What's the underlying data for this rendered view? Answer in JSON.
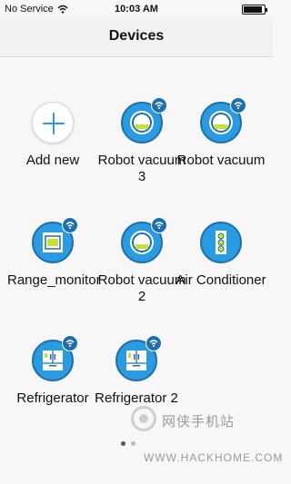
{
  "status_bar": {
    "carrier": "No Service",
    "time": "10:03 AM",
    "battery_level": 0.9
  },
  "header": {
    "title": "Devices"
  },
  "devices": [
    {
      "label": "Add new",
      "icon": "plus-icon"
    },
    {
      "label": "Robot vacuum 3",
      "icon": "robot-vacuum-icon",
      "wifi": true
    },
    {
      "label": "Robot vacuum",
      "icon": "robot-vacuum-icon",
      "wifi": true
    },
    {
      "label": "Range_monitor",
      "icon": "range-oven-icon",
      "wifi": true
    },
    {
      "label": "Robot vacuum 2",
      "icon": "robot-vacuum-icon",
      "wifi": true
    },
    {
      "label": "Air Conditioner",
      "icon": "air-conditioner-icon",
      "wifi": false
    },
    {
      "label": "Refrigerator",
      "icon": "refrigerator-icon",
      "wifi": true
    },
    {
      "label": "Refrigerator 2",
      "icon": "refrigerator-icon",
      "wifi": true
    }
  ],
  "pager": {
    "pages": 2,
    "current": 1
  },
  "watermark": {
    "brand": "网侠手机站",
    "url": "WWW.HACKHOME.COM"
  },
  "colors": {
    "accent": "#2a9be0",
    "accent_dark": "#1e6fb0",
    "lime": "#c8e034"
  }
}
